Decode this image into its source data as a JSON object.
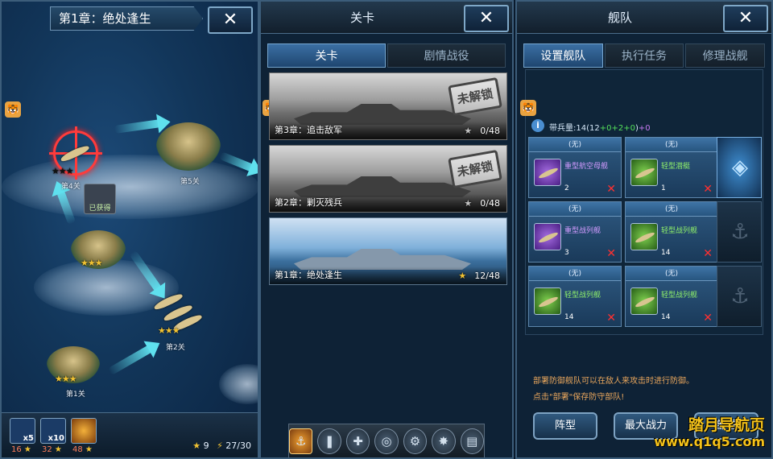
{
  "colors": {
    "accent": "#5fe0ee",
    "star": "#f1c232",
    "stamp_red": "#d21f1f",
    "note_orange": "#e8a65c",
    "purple_type": "#d29bff",
    "green_type": "#8ff06a"
  },
  "map": {
    "chapter_title": "第1章：绝处逢生",
    "close_label": "✕",
    "obtained_label": "已获得",
    "nodes": [
      {
        "label": "第1关",
        "stars": "★★★"
      },
      {
        "label": "第2关",
        "stars": "★★★"
      },
      {
        "label": "",
        "stars": "★★★"
      },
      {
        "label": "第4关",
        "stars": "★★★"
      },
      {
        "label": "第5关",
        "stars": ""
      }
    ],
    "rewards": [
      {
        "multiplier": "x5",
        "stars_needed": "16",
        "icon": "box-icon"
      },
      {
        "multiplier": "x10",
        "stars_needed": "32",
        "icon": "box-icon"
      },
      {
        "multiplier": "",
        "stars_needed": "48",
        "icon": "box-icon"
      }
    ],
    "star_icon": "★",
    "stars_count": "9",
    "energy": "27/30",
    "bolt_icon": "⚡"
  },
  "stage": {
    "title": "关卡",
    "close_label": "✕",
    "tabs": [
      "关卡",
      "剧情战役"
    ],
    "locked_stamp": "未解锁",
    "cards": [
      {
        "title": "第3章：追击敌军",
        "progress": "0/48",
        "locked": true
      },
      {
        "title": "第2章：剿灭残兵",
        "progress": "0/48",
        "locked": true
      },
      {
        "title": "第1章：绝处逢生",
        "progress": "12/48",
        "locked": false
      }
    ],
    "bottom_icons": [
      "fleet-icon",
      "shell-icon",
      "repair-icon",
      "radar-icon",
      "gear-icon",
      "medal-icon",
      "scroll-icon"
    ]
  },
  "fleet": {
    "title": "舰队",
    "close_label": "✕",
    "tabs": [
      "设置舰队",
      "执行任务",
      "修理战舰"
    ],
    "info_icon": "i",
    "capacity_prefix": "带兵量:14(12",
    "capacity_green": "+0+2+0",
    "capacity_mid": ")",
    "capacity_purple": "+0",
    "slots": [
      {
        "head": "(无)",
        "type": "重型航空母舰",
        "count": "2",
        "tier": "purple"
      },
      {
        "head": "(无)",
        "type": "轻型潜艇",
        "count": "1",
        "tier": "green"
      },
      {
        "head": "(无)",
        "type": "重型战列舰",
        "count": "3",
        "tier": "purple"
      },
      {
        "head": "(无)",
        "type": "轻型战列舰",
        "count": "14",
        "tier": "green"
      },
      {
        "head": "(无)",
        "type": "轻型战列舰",
        "count": "14",
        "tier": "green"
      },
      {
        "head": "(无)",
        "type": "轻型战列舰",
        "count": "14",
        "tier": "green"
      }
    ],
    "remove_mark": "✕",
    "anchor_icon": "⚓",
    "note1": "部署防御舰队可以在敌人来攻击时进行防御。",
    "note2": "点击\"部署\"保存防守部队!",
    "buttons": [
      "阵型",
      "最大战力",
      "部署"
    ],
    "watermark_line1": "踏月导航页",
    "watermark_line2": "www.q1q5.com"
  }
}
